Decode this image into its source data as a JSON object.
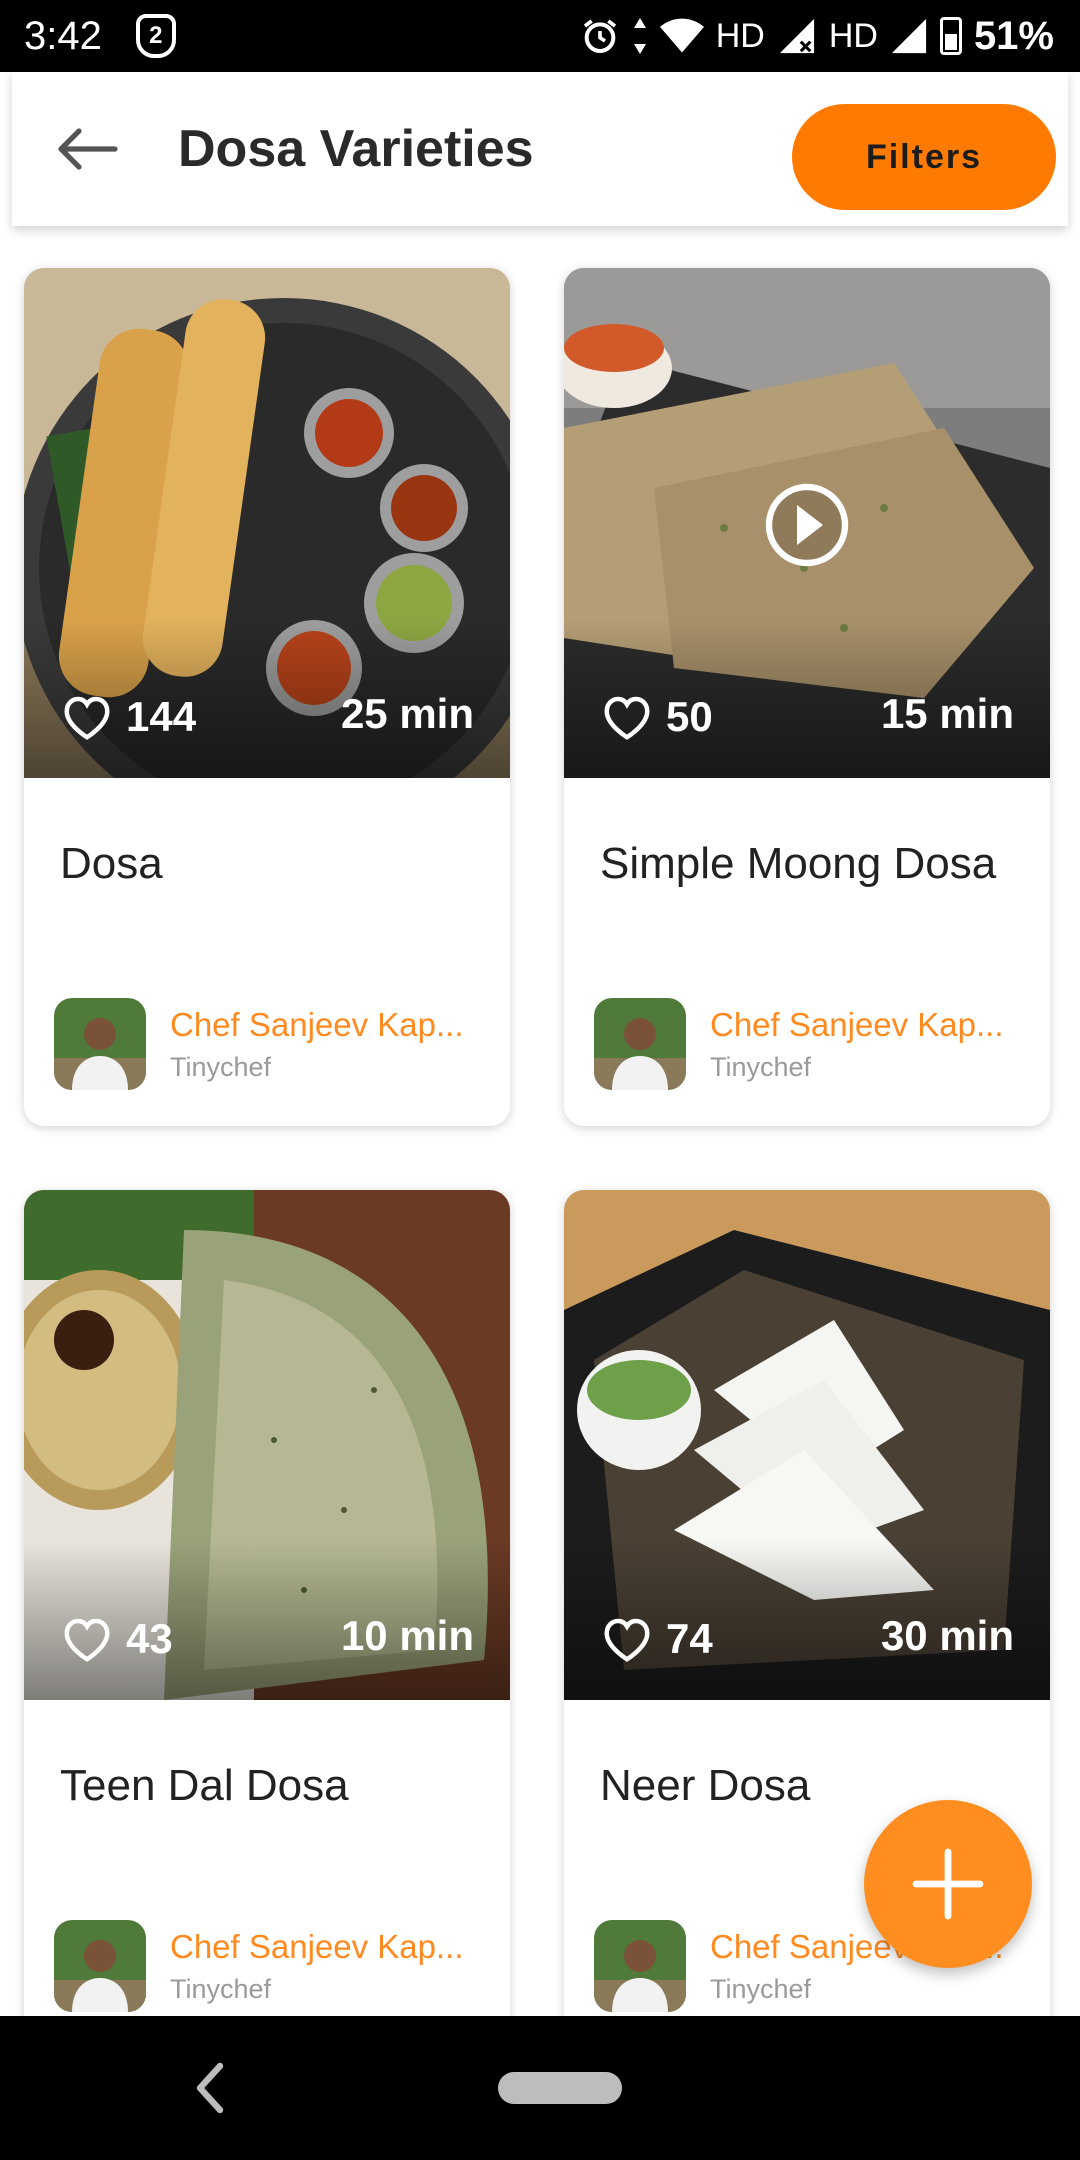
{
  "status_bar": {
    "time": "3:42",
    "badge_number": "2",
    "network_label_1": "HD",
    "network_label_2": "HD",
    "battery_percent": "51%"
  },
  "header": {
    "title": "Dosa Varieties",
    "filters_label": "Filters"
  },
  "recipes": [
    {
      "title": "Dosa",
      "likes": "144",
      "duration": "25 min",
      "author": "Chef Sanjeev Kap...",
      "source": "Tinychef",
      "has_video": false
    },
    {
      "title": "Simple Moong Dosa",
      "likes": "50",
      "duration": "15 min",
      "author": "Chef Sanjeev Kap...",
      "source": "Tinychef",
      "has_video": true
    },
    {
      "title": "Teen Dal Dosa",
      "likes": "43",
      "duration": "10 min",
      "author": "Chef Sanjeev Kap...",
      "source": "Tinychef",
      "has_video": false
    },
    {
      "title": "Neer Dosa",
      "likes": "74",
      "duration": "30 min",
      "author": "Chef Sanjeev Kap...",
      "source": "Tinychef",
      "has_video": false
    }
  ],
  "colors": {
    "accent": "#ff7a00",
    "fab": "#ff8d1f",
    "author_name": "#ff8a20"
  },
  "icons": {
    "back": "arrow-left-icon",
    "like": "heart-outline-icon",
    "play": "play-circle-icon",
    "fab": "plus-icon"
  }
}
